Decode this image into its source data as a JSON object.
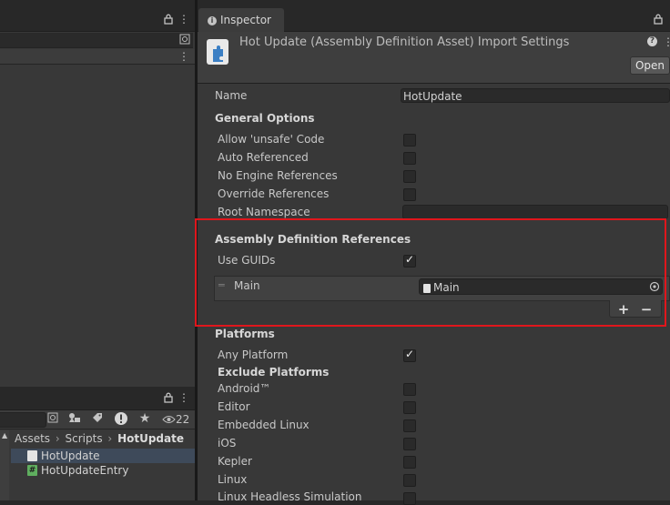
{
  "project_panel": {
    "breadcrumb": [
      "Assets",
      "Scripts",
      "HotUpdate"
    ],
    "visible_count": "22",
    "files": [
      {
        "name": "HotUpdate",
        "icon": "asmdef-icon",
        "selected": true
      },
      {
        "name": "HotUpdateEntry",
        "icon": "csharp-script-icon",
        "selected": false
      }
    ]
  },
  "inspector": {
    "tab_label": "Inspector",
    "asset_title": "Hot Update (Assembly Definition Asset) Import Settings",
    "open_button": "Open",
    "name_label": "Name",
    "name_value": "HotUpdate",
    "general_options": {
      "title": "General Options",
      "items": [
        {
          "label": "Allow 'unsafe' Code",
          "checked": false
        },
        {
          "label": "Auto Referenced",
          "checked": false
        },
        {
          "label": "No Engine References",
          "checked": false
        },
        {
          "label": "Override References",
          "checked": false
        }
      ],
      "root_namespace_label": "Root Namespace",
      "root_namespace_value": ""
    },
    "references": {
      "title": "Assembly Definition References",
      "use_guids_label": "Use GUIDs",
      "use_guids_checked": true,
      "items": [
        {
          "label": "Main",
          "value": "Main"
        }
      ],
      "add_label": "+",
      "remove_label": "−"
    },
    "platforms": {
      "title": "Platforms",
      "any_platform_label": "Any Platform",
      "any_platform_checked": true,
      "exclude_title": "Exclude Platforms",
      "items": [
        {
          "label": "Android™",
          "checked": false
        },
        {
          "label": "Editor",
          "checked": false
        },
        {
          "label": "Embedded Linux",
          "checked": false
        },
        {
          "label": "iOS",
          "checked": false
        },
        {
          "label": "Kepler",
          "checked": false
        },
        {
          "label": "Linux",
          "checked": false
        },
        {
          "label": "Linux Headless Simulation",
          "checked": false
        }
      ]
    }
  },
  "colors": {
    "highlight": "#e0161c",
    "selection": "#3e4a5a",
    "asmdef_icon": "#6aa0d8",
    "script_icon": "#5fae5f"
  }
}
